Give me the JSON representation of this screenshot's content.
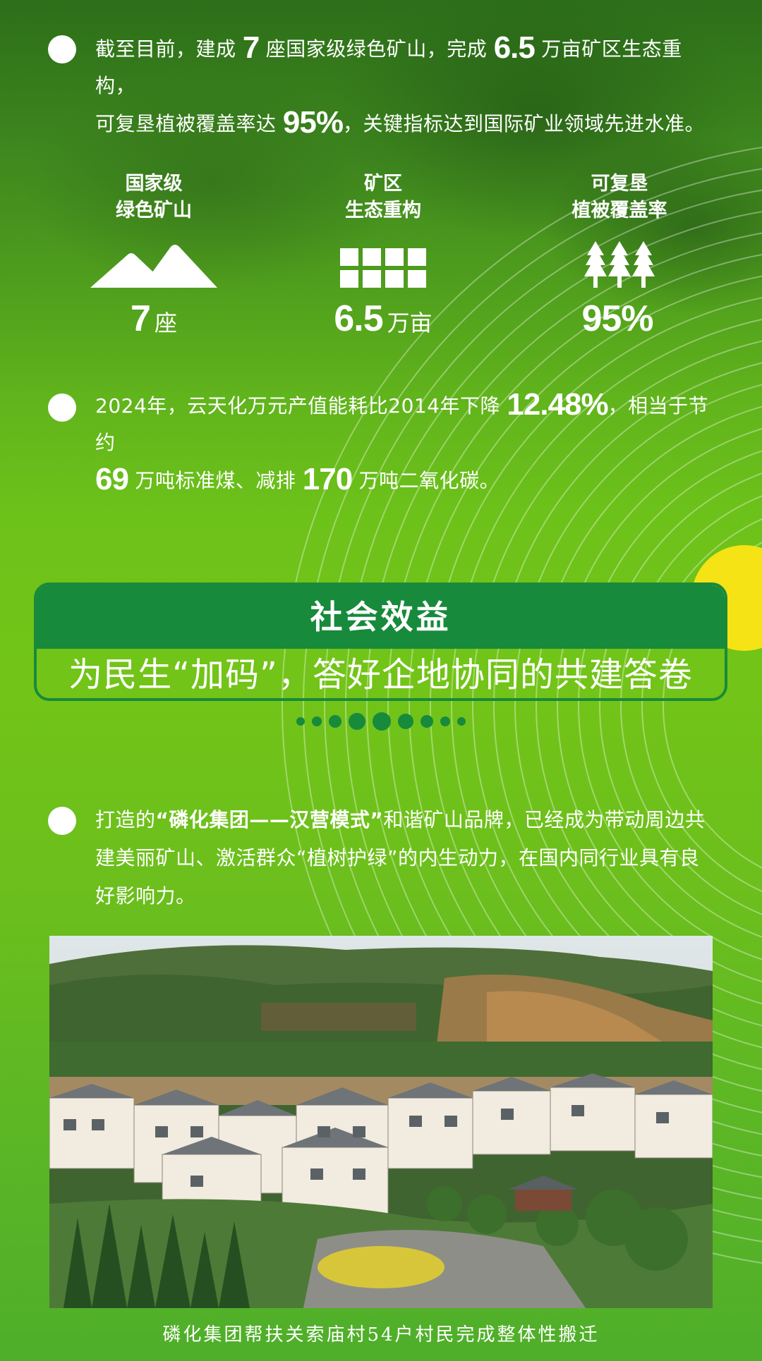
{
  "section1": {
    "line1_a": "截至目前，建成 ",
    "line1_b": "7",
    "line1_c": " 座国家级绿色矿山，完成 ",
    "line1_d": "6.5",
    "line1_e": " 万亩矿区生态重构，",
    "line2_a": "可复垦植被覆盖率达 ",
    "line2_b": "95%",
    "line2_c": "，关键指标达到国际矿业领域先进水准。"
  },
  "stats": [
    {
      "label1": "国家级",
      "label2": "绿色矿山",
      "icon": "mountain-icon",
      "value": "7",
      "unit": "座"
    },
    {
      "label1": "矿区",
      "label2": "生态重构",
      "icon": "grid-icon",
      "value": "6.5",
      "unit": "万亩"
    },
    {
      "label1": "可复垦",
      "label2": "植被覆盖率",
      "icon": "trees-icon",
      "value": "95%",
      "unit": ""
    }
  ],
  "section2": {
    "a": "2024年，云天化万元产值能耗比2014年下降 ",
    "b": "12.48%",
    "c": "，相当于节约",
    "d": "69",
    "e": " 万吨标准煤、减排 ",
    "f": "170",
    "g": " 万吨二氧化碳。"
  },
  "banner": {
    "title": "社会效益",
    "subtitle": "为民生“加码”，答好企地协同的共建答卷"
  },
  "section3": {
    "a": "打造的",
    "b": "“磷化集团——汉营模式”",
    "c": "和谐矿山品牌，已经成为带动周边共建美丽矿山、激活群众“植树护绿”的内生动力，在国内同行业具有良好影响力。"
  },
  "caption": "磷化集团帮扶关索庙村54户村民完成整体性搬迁",
  "colors": {
    "banner_green": "#178a3c",
    "accent_yellow": "#f5e316"
  }
}
